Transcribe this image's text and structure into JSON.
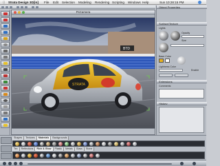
{
  "menubar": {
    "apple": "",
    "app_name": "Strata Design 3D[in]",
    "menus": [
      "File",
      "Edit",
      "Selection",
      "Modeling",
      "Rendering",
      "Scripting",
      "Windows",
      "Help"
    ],
    "clock": "Sun 10:28:15 PM",
    "tab_label": "Object Properties"
  },
  "viewport": {
    "title": "PsCamera"
  },
  "right_panel": {
    "top_header": "Object Properties",
    "surface_header": "Surface/Texture",
    "lights_label": "Lights",
    "opacity_label": "Opacity",
    "size_label": "Size",
    "base_color_label": "Base Color",
    "lightness_label": "Lightness Color",
    "enable_label": "Enable",
    "extensions_header": "Extensions",
    "comments_label": "Comments",
    "history_header": "History"
  },
  "resources": {
    "tabs_row1": [
      "Shapes",
      "Textures",
      "Materials",
      "Backgrounds"
    ],
    "tabs_row2": [
      "Tex",
      "Reflections",
      "Rich & Glow",
      "Plastic",
      "Metals",
      "Glass",
      "Stone"
    ]
  },
  "colors": {
    "sky_top": "#2b3a66",
    "car_yellow": "#e8b21f",
    "car_silver": "#c8ccd2",
    "stand_blue": "#2d56b8",
    "ground": "#6e7079",
    "panel": "#b7bcc4",
    "accent_red": "#d23a2a"
  }
}
